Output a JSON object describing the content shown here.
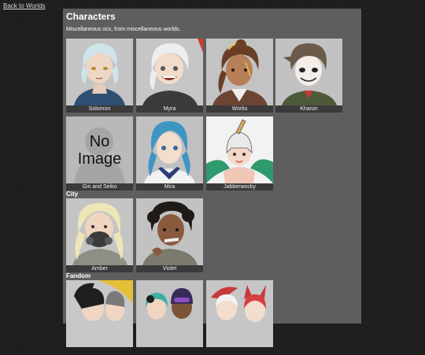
{
  "nav": {
    "back_label": "Back to Worlds"
  },
  "page": {
    "title": "Characters",
    "subtitle": "Miscellaneous ocs, from miscellaneous worlds."
  },
  "groups": {
    "city": "City",
    "fandom": "Fandom"
  },
  "cards": {
    "solomon": "Solomon",
    "myra": "Myra",
    "works": "Works",
    "kharon": "Kharon",
    "gin": "Gin and Seiko",
    "mira": "Mira",
    "jabberwocky": "Jabberwocky",
    "amber": "Amber",
    "violet": "Violet"
  },
  "placeholder": {
    "line1": "No",
    "line2": "Image"
  }
}
